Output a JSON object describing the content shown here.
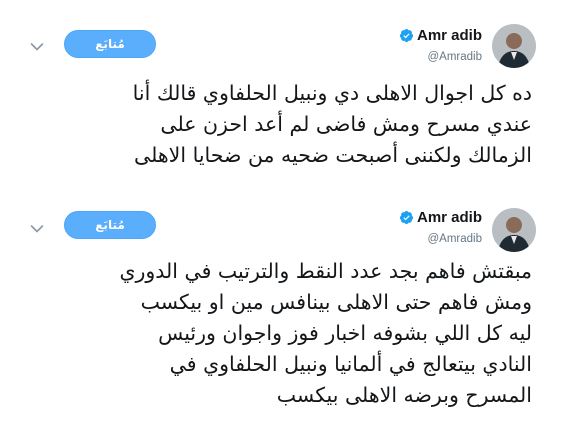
{
  "tweets": [
    {
      "author": {
        "display_name": "Amr adib",
        "handle": "@Amradib",
        "verified_icon": "verified-badge-icon"
      },
      "follow_label": "مُتابَع",
      "text_lines": [
        "ده كل اجوال الاهلى دي ونبيل الحلفاوي قالك أنا",
        "عندي مسرح ومش فاضى لم أعد احزن على",
        "الزمالك ولكننى أصبحت ضحيه من ضحايا الاهلى"
      ]
    },
    {
      "author": {
        "display_name": "Amr adib",
        "handle": "@Amradib",
        "verified_icon": "verified-badge-icon"
      },
      "follow_label": "مُتابَع",
      "text_lines": [
        "مبقتش فاهم بجد عدد النقط والترتيب في الدوري",
        "ومش فاهم حتى الاهلى بينافس مين او بيكسب",
        "ليه كل اللي بشوفه اخبار فوز واجوان ورئيس",
        "النادي بيتعالج في ألمانيا  ونبيل الحلفاوي في",
        "المسرح وبرضه الاهلى بيكسب"
      ]
    }
  ],
  "colors": {
    "follow_button_bg": "#5aaefb",
    "verified_blue": "#1da1f2",
    "handle_gray": "#657786",
    "text": "#14171a"
  }
}
